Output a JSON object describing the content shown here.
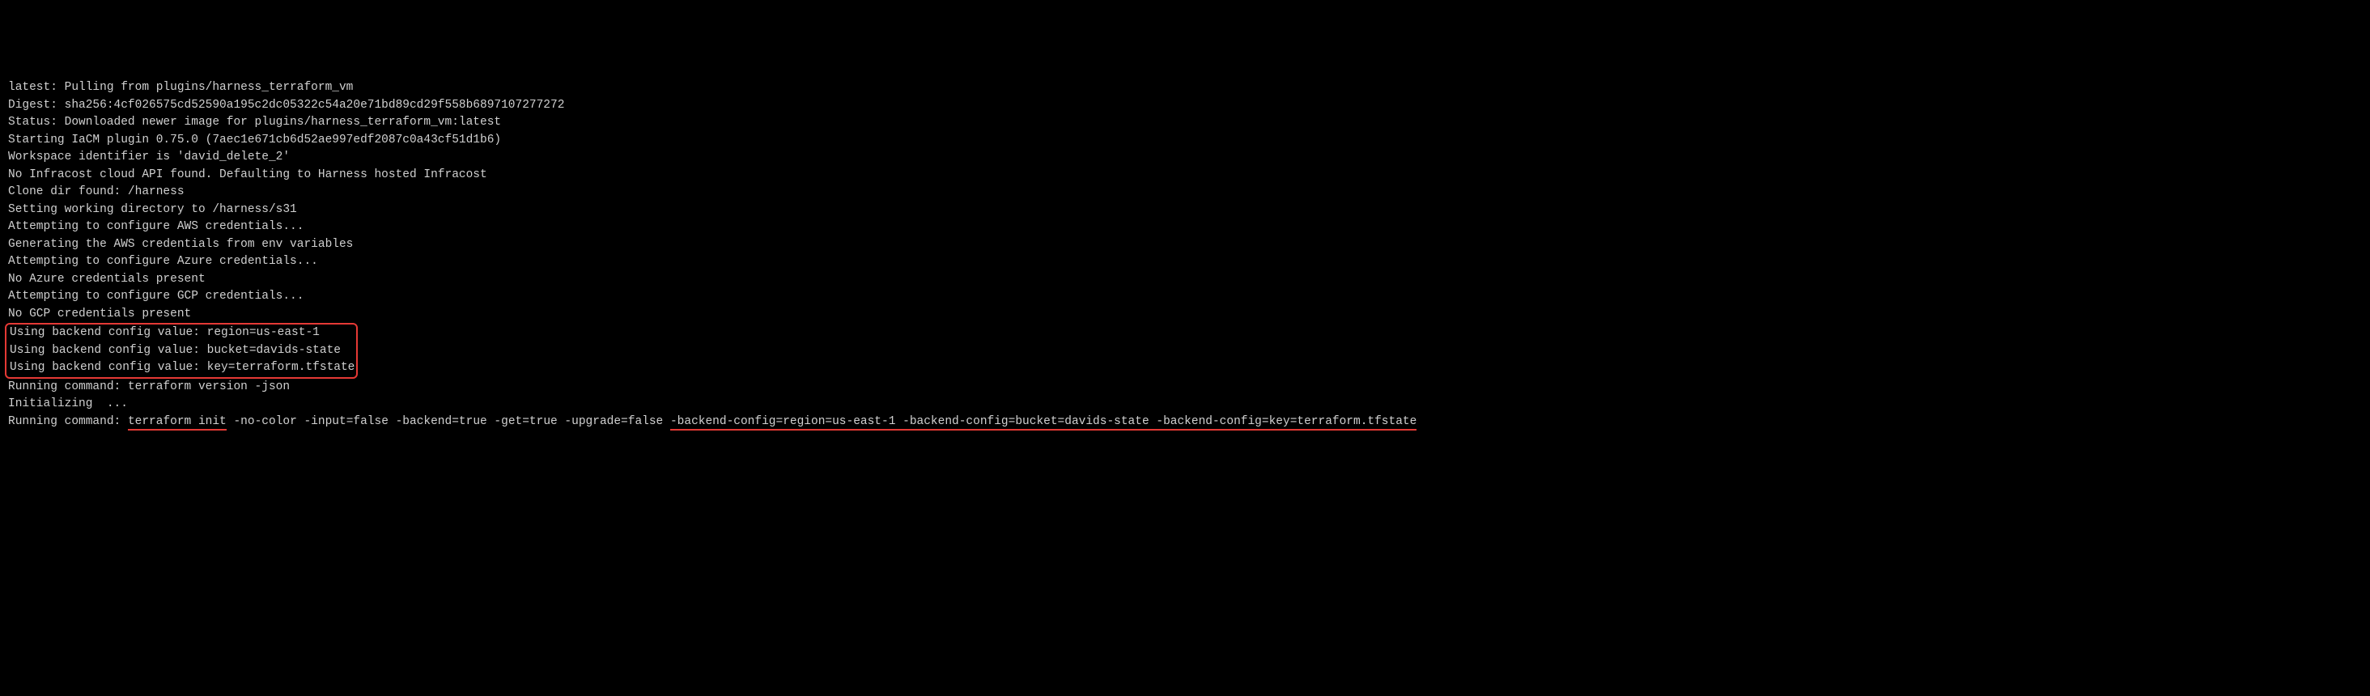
{
  "log": {
    "lines": [
      "latest: Pulling from plugins/harness_terraform_vm",
      "Digest: sha256:4cf026575cd52590a195c2dc05322c54a20e71bd89cd29f558b6897107277272",
      "Status: Downloaded newer image for plugins/harness_terraform_vm:latest",
      "Starting IaCM plugin 0.75.0 (7aec1e671cb6d52ae997edf2087c0a43cf51d1b6)",
      "Workspace identifier is 'david_delete_2'",
      "No Infracost cloud API found. Defaulting to Harness hosted Infracost",
      "Clone dir found: /harness",
      "Setting working directory to /harness/s31",
      "Attempting to configure AWS credentials...",
      "Generating the AWS credentials from env variables",
      "Attempting to configure Azure credentials...",
      "No Azure credentials present",
      "Attempting to configure GCP credentials...",
      "No GCP credentials present"
    ],
    "boxed": [
      "Using backend config value: region=us-east-1",
      "Using backend config value: bucket=davids-state",
      "Using backend config value: key=terraform.tfstate"
    ],
    "after_box": [
      "Running command: terraform version -json",
      "Initializing  ..."
    ],
    "last_line": {
      "prefix": "Running command: ",
      "underlined_cmd": "terraform init",
      "middle_flags": " -no-color -input=false -backend=true -get=true -upgrade=false ",
      "underlined_backend": "-backend-config=region=us-east-1 -backend-config=bucket=davids-state -backend-config=key=terraform.tfstate"
    }
  }
}
